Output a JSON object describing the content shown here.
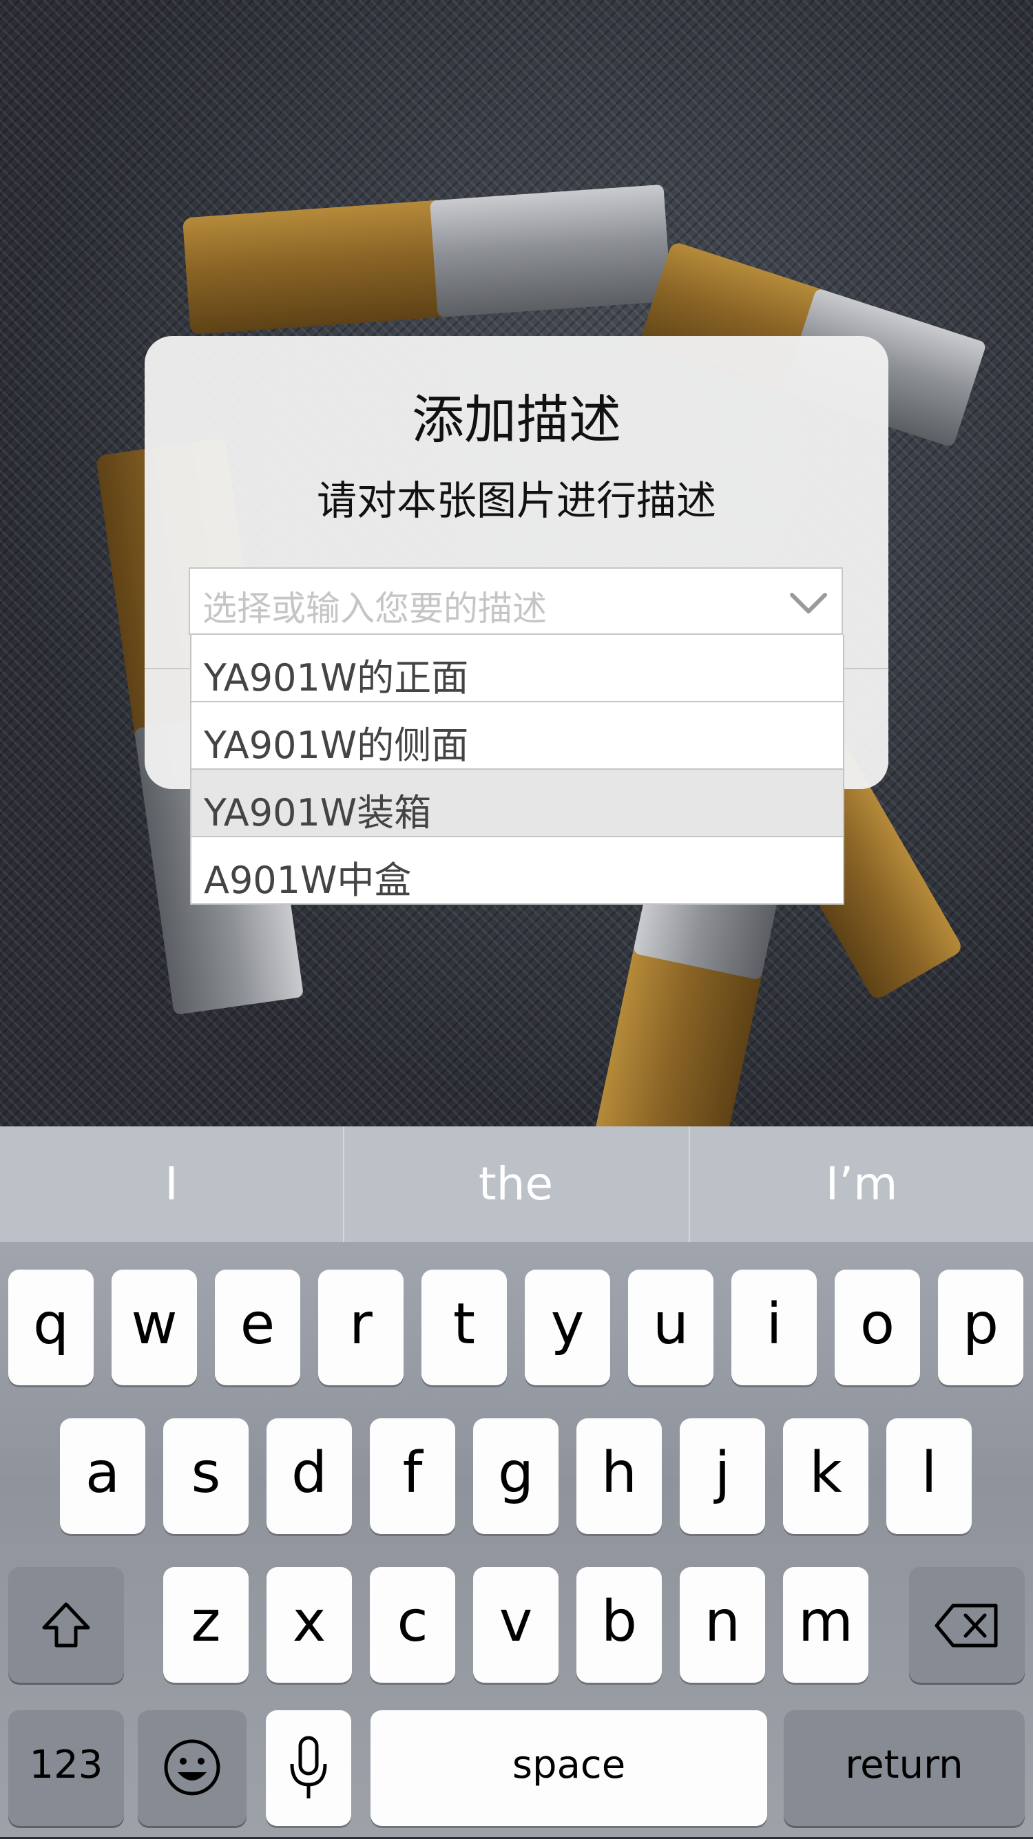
{
  "dialog": {
    "title": "添加描述",
    "subtitle": "请对本张图片进行描述",
    "select": {
      "placeholder": "选择或输入您要的描述",
      "options": [
        "YA901W的正面",
        "YA901W的侧面",
        "YA901W装箱",
        "A901W中盒"
      ],
      "highlighted_index": 2
    }
  },
  "keyboard": {
    "suggestions": [
      "I",
      "the",
      "I’m"
    ],
    "row1": [
      "q",
      "w",
      "e",
      "r",
      "t",
      "y",
      "u",
      "i",
      "o",
      "p"
    ],
    "row2": [
      "a",
      "s",
      "d",
      "f",
      "g",
      "h",
      "j",
      "k",
      "l"
    ],
    "row3": [
      "z",
      "x",
      "c",
      "v",
      "b",
      "n",
      "m"
    ],
    "numbers_label": "123",
    "space_label": "space",
    "return_label": "return",
    "icons": [
      "shift-icon",
      "backspace-icon",
      "emoji-icon",
      "microphone-icon"
    ]
  }
}
